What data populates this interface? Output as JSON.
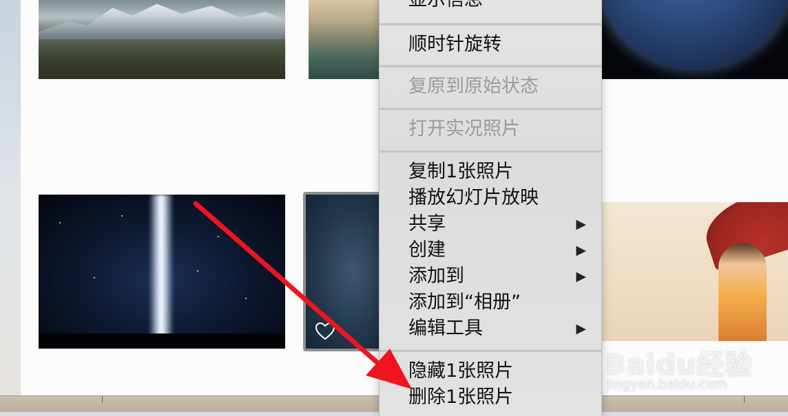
{
  "menu": {
    "items": [
      {
        "label": "显示信息",
        "enabled": true,
        "submenu": false
      },
      {
        "label": "顺时针旋转",
        "enabled": true,
        "submenu": false
      },
      {
        "label": "复原到原始状态",
        "enabled": false,
        "submenu": false
      },
      {
        "label": "打开实况照片",
        "enabled": false,
        "submenu": false
      },
      {
        "label": "复制1张照片",
        "enabled": true,
        "submenu": false
      },
      {
        "label": "播放幻灯片放映",
        "enabled": true,
        "submenu": false
      },
      {
        "label": "共享",
        "enabled": true,
        "submenu": true
      },
      {
        "label": "创建",
        "enabled": true,
        "submenu": true
      },
      {
        "label": "添加到",
        "enabled": true,
        "submenu": true
      },
      {
        "label": "添加到“相册”",
        "enabled": true,
        "submenu": false
      },
      {
        "label": "编辑工具",
        "enabled": true,
        "submenu": true
      },
      {
        "label": "隐藏1张照片",
        "enabled": true,
        "submenu": false
      },
      {
        "label": "删除1张照片",
        "enabled": true,
        "submenu": false
      }
    ],
    "submenu_arrow": "▶"
  },
  "watermark": {
    "logo": "Baidu经验",
    "url": "jingyan.baidu.com"
  },
  "photos": [
    {
      "name": "mountain-photo"
    },
    {
      "name": "arch-rock-photo"
    },
    {
      "name": "planet-photo"
    },
    {
      "name": "light-beam-photo"
    },
    {
      "name": "selected-night-photo",
      "favorite_icon": "heart-icon"
    },
    {
      "name": "parasol-girl-photo"
    }
  ],
  "colors": {
    "annotation_arrow": "#f0141e",
    "menu_background": "#dedede",
    "disabled_text": "#9b9b9b"
  }
}
